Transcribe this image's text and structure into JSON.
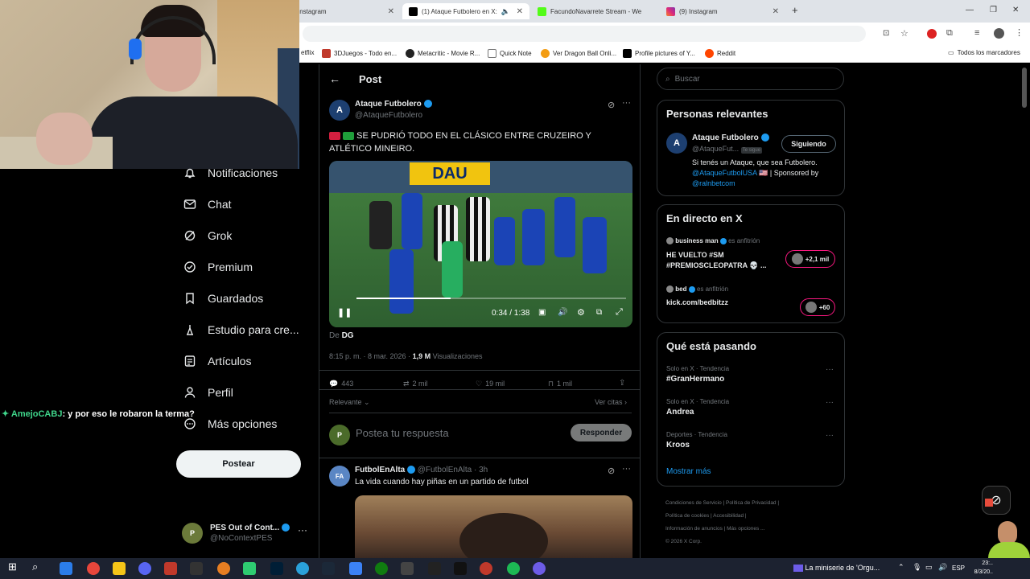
{
  "browser": {
    "tabs": [
      {
        "title": "Instagram",
        "active": false,
        "icon": "instagram-icon"
      },
      {
        "title": "(1) Ataque Futbolero en X:",
        "active": true,
        "icon": "x-icon"
      },
      {
        "title": "FacundoNavarrete Stream - We",
        "active": false,
        "icon": "kick-icon"
      },
      {
        "title": "(9) Instagram",
        "active": false,
        "icon": "instagram-icon"
      }
    ],
    "new_tab": "+",
    "bookmarks": [
      "etflix",
      "3DJuegos - Todo en...",
      "Metacritic - Movie R...",
      "Quick Note",
      "Ver Dragon Ball Onli...",
      "Profile pictures of Y...",
      "Reddit"
    ],
    "all_bookmarks": "Todos los marcadores"
  },
  "chat_overlay": {
    "user": "AmejoCABJ",
    "message": ": y por eso le robaron la terma?"
  },
  "sidebar": {
    "items": [
      {
        "label": "Notificaciones",
        "icon": "bell-icon"
      },
      {
        "label": "Chat",
        "icon": "mail-icon"
      },
      {
        "label": "Grok",
        "icon": "grok-icon"
      },
      {
        "label": "Premium",
        "icon": "premium-icon"
      },
      {
        "label": "Guardados",
        "icon": "bookmark-icon"
      },
      {
        "label": "Estudio para cre...",
        "icon": "studio-icon"
      },
      {
        "label": "Artículos",
        "icon": "article-icon"
      },
      {
        "label": "Perfil",
        "icon": "person-icon"
      },
      {
        "label": "Más opciones",
        "icon": "more-icon"
      }
    ],
    "post_button": "Postear",
    "account": {
      "name": "PES Out of Cont...",
      "handle": "@NoContextPES"
    }
  },
  "post": {
    "header": "Post",
    "author": "Ataque Futbolero",
    "handle": "@AtaqueFutbolero",
    "text": "SE PUDRIÓ TODO EN EL CLÁSICO ENTRE CRUZEIRO Y ATLÉTICO MINEIRO.",
    "video_time": "0:34 / 1:38",
    "video_progress": 0.35,
    "from_label": "De",
    "from_source": "DG",
    "timestamp": "8:15 p. m. · 8 mar. 2026 ·",
    "views": "1,9 M",
    "views_label": "Visualizaciones",
    "replies": "443",
    "reposts": "2 mil",
    "likes": "19 mil",
    "bookmarks": "1 mil",
    "sort": "Relevante",
    "quotes": "Ver citas",
    "reply_placeholder": "Postea tu respuesta",
    "reply_button": "Responder"
  },
  "second_post": {
    "author": "FutbolEnAlta",
    "handle": "@FutbolEnAlta · 3h",
    "text": "La vida cuando hay piñas en un partido de futbol"
  },
  "search": {
    "placeholder": "Buscar"
  },
  "relevant": {
    "title": "Personas relevantes",
    "name": "Ataque Futbolero",
    "handle": "@AtaqueFut...",
    "follows_you": "Te sigue",
    "button": "Siguiendo",
    "bio": "Si tenés un Ataque, que sea Futbolero.",
    "bio_link1": "@AtaqueFutbolUSA",
    "bio_mid": "🇺🇸 | Sponsored by",
    "bio_link2": "@ralnbetcom"
  },
  "live": {
    "title": "En directo en X",
    "items": [
      {
        "host": "business man",
        "role": "es anfitrión",
        "text": "HE VUELTO #SM #PREMIOSCLEOPATRA 💀 ...",
        "count": "+2,1 mil"
      },
      {
        "host": "bed",
        "role": "es anfitrión",
        "text": "kick.com/bedbitzz",
        "count": "+60"
      }
    ]
  },
  "trends": {
    "title": "Qué está pasando",
    "items": [
      {
        "context": "Solo en X · Tendencia",
        "name": "#GranHermano"
      },
      {
        "context": "Solo en X · Tendencia",
        "name": "Andrea"
      },
      {
        "context": "Deportes · Tendencia",
        "name": "Kroos"
      }
    ],
    "more": "Mostrar más"
  },
  "footer": {
    "links": [
      "Condiciones de Servicio",
      "Política de Privacidad",
      "Política de cookies",
      "Accesibilidad",
      "Información de anuncios",
      "Más opciones ..."
    ],
    "copy": "© 2026 X Corp."
  },
  "taskbar": {
    "media": "La miniserie de 'Orgu...",
    "lang": "ESP",
    "time": "23:..",
    "date": "8/3/20.."
  }
}
